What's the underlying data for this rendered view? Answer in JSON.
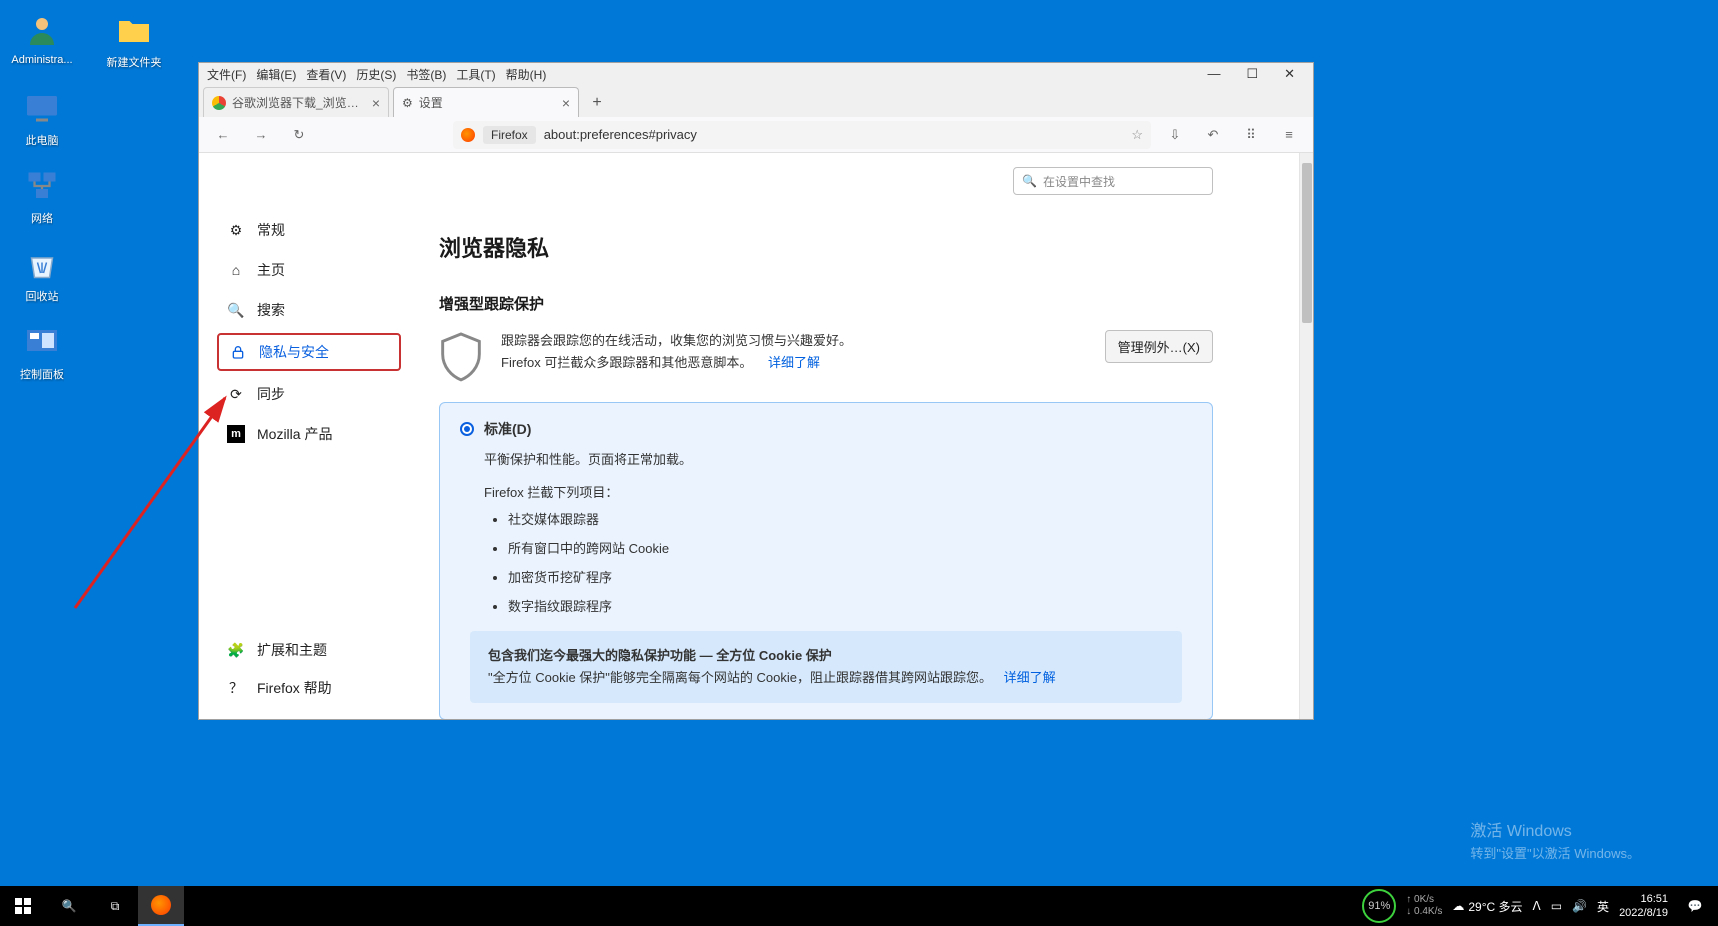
{
  "desktop": {
    "icons": [
      "Administra...",
      "新建文件夹",
      "此电脑",
      "网络",
      "回收站",
      "控制面板"
    ]
  },
  "menubar": [
    "文件(F)",
    "编辑(E)",
    "查看(V)",
    "历史(S)",
    "书签(B)",
    "工具(T)",
    "帮助(H)"
  ],
  "tabs": {
    "t1": "谷歌浏览器下载_浏览器官网入口",
    "t2": "设置"
  },
  "url": {
    "label": "Firefox",
    "text": "about:preferences#privacy"
  },
  "sidebar": {
    "general": "常规",
    "home": "主页",
    "search": "搜索",
    "privacy": "隐私与安全",
    "sync": "同步",
    "mozilla": "Mozilla 产品",
    "ext": "扩展和主题",
    "help": "Firefox 帮助"
  },
  "search_placeholder": "在设置中查找",
  "headings": {
    "h1": "浏览器隐私",
    "h2": "增强型跟踪保护"
  },
  "tracking": {
    "line1": "跟踪器会跟踪您的在线活动，收集您的浏览习惯与兴趣爱好。",
    "line2": "Firefox 可拦截众多跟踪器和其他恶意脚本。",
    "learn": "详细了解",
    "manage": "管理例外…(X)"
  },
  "card": {
    "title": "标准(D)",
    "sub": "平衡保护和性能。页面将正常加载。",
    "blocks_label": "Firefox 拦截下列项目：",
    "items": [
      "社交媒体跟踪器",
      "所有窗口中的跨网站 Cookie",
      "加密货币挖矿程序",
      "数字指纹跟踪程序"
    ]
  },
  "infobox": {
    "bold": "包含我们迄今最强大的隐私保护功能 — 全方位 Cookie 保护",
    "text": "\"全方位 Cookie 保护\"能够完全隔离每个网站的 Cookie，阻止跟踪器借其跨网站跟踪您。",
    "link": "详细了解"
  },
  "watermark": {
    "l1": "激活 Windows",
    "l2": "转到\"设置\"以激活 Windows。"
  },
  "taskbar": {
    "battery": "91%",
    "net_up": "0K/s",
    "net_down": "0.4K/s",
    "weather": "29°C 多云",
    "ime": "英",
    "time": "16:51",
    "date": "2022/8/19"
  }
}
